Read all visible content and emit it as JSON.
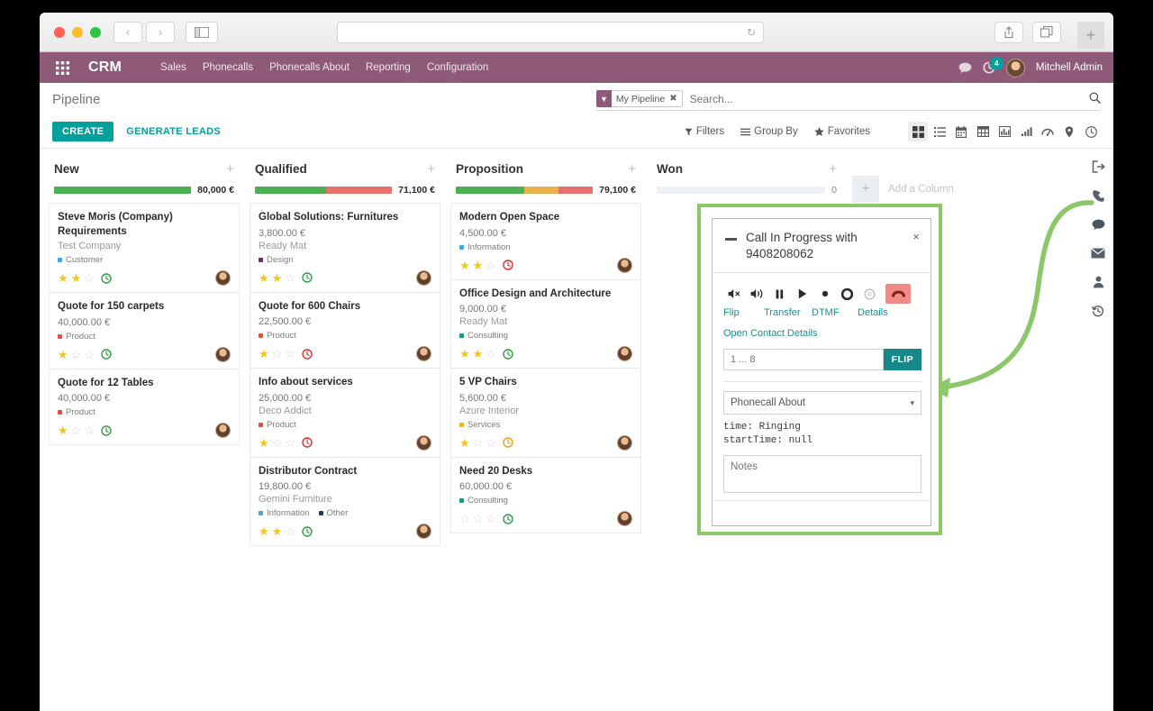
{
  "browser": {
    "traffic_lights": [
      "close",
      "minimize",
      "maximize"
    ],
    "back_label": "‹",
    "forward_label": "›",
    "sidebar_icon": "sidebar-toggle-icon",
    "address_value": "",
    "reload_label": "↻",
    "share_icon": "share-icon",
    "tabs_icon": "tab-overview-icon",
    "newtab_label": "+"
  },
  "nav": {
    "apps_icon": "apps-grid-icon",
    "brand": "CRM",
    "menu": [
      "Sales",
      "Phonecalls",
      "Phonecalls About",
      "Reporting",
      "Configuration"
    ],
    "messages_icon": "chat-bubble-icon",
    "activity_icon": "activity-clock-icon",
    "activity_count": "4",
    "user": "Mitchell Admin",
    "bg_color": "#8f5a78"
  },
  "control_panel": {
    "breadcrumb": "Pipeline",
    "create_label": "CREATE",
    "generate_leads_label": "GENERATE LEADS",
    "accent_color": "#00a09d",
    "search": {
      "facet_label": "My Pipeline",
      "facet_remove": "✖",
      "placeholder": "Search...",
      "value": ""
    },
    "filters_label": "Filters",
    "groupby_label": "Group By",
    "favorites_label": "Favorites",
    "views": [
      {
        "name": "kanban",
        "glyph": "kanban-view-icon",
        "active": true
      },
      {
        "name": "list",
        "glyph": "list-view-icon",
        "active": false
      },
      {
        "name": "calendar",
        "glyph": "calendar-view-icon",
        "active": false
      },
      {
        "name": "pivot",
        "glyph": "pivot-view-icon",
        "active": false
      },
      {
        "name": "graph-bar",
        "glyph": "bar-chart-view-icon",
        "active": false
      },
      {
        "name": "graph-line",
        "glyph": "line-chart-view-icon",
        "active": false
      },
      {
        "name": "dashboard",
        "glyph": "gauge-view-icon",
        "active": false
      },
      {
        "name": "map",
        "glyph": "map-pin-view-icon",
        "active": false
      },
      {
        "name": "activity",
        "glyph": "clock-view-icon",
        "active": false
      }
    ]
  },
  "kanban": {
    "add_column_label": "Add a Column",
    "add_column_plus": "+",
    "columns": [
      {
        "title": "New",
        "amount": "80,000 €",
        "meter": [
          {
            "color": "#4caf50",
            "pct": 100
          }
        ],
        "cards": [
          {
            "title": "Steve Moris (Company) Requirements",
            "amount": "",
            "partner": "Test Company",
            "tags": [
              {
                "label": "Customer",
                "color": "#3fa9d8"
              }
            ],
            "stars": 2,
            "clock_color": "#2f9e44"
          },
          {
            "title": "Quote for 150 carpets",
            "amount": "40,000.00 €",
            "partner": "",
            "tags": [
              {
                "label": "Product",
                "color": "#e74c3c"
              }
            ],
            "stars": 1,
            "clock_color": "#2f9e44"
          },
          {
            "title": "Quote for 12 Tables",
            "amount": "40,000.00 €",
            "partner": "",
            "tags": [
              {
                "label": "Product",
                "color": "#e74c3c"
              }
            ],
            "stars": 1,
            "clock_color": "#2f9e44"
          }
        ]
      },
      {
        "title": "Qualified",
        "amount": "71,100 €",
        "meter": [
          {
            "color": "#4caf50",
            "pct": 52
          },
          {
            "color": "#e8716b",
            "pct": 48
          }
        ],
        "cards": [
          {
            "title": "Global Solutions: Furnitures",
            "amount": "3,800.00 €",
            "partner": "Ready Mat",
            "tags": [
              {
                "label": "Design",
                "color": "#6b2f6b"
              }
            ],
            "stars": 2,
            "clock_color": "#2f9e44"
          },
          {
            "title": "Quote for 600 Chairs",
            "amount": "22,500.00 €",
            "partner": "",
            "tags": [
              {
                "label": "Product",
                "color": "#e74c3c"
              }
            ],
            "stars": 1,
            "clock_color": "#e03131"
          },
          {
            "title": "Info about services",
            "amount": "25,000.00 €",
            "partner": "Deco Addict",
            "tags": [
              {
                "label": "Product",
                "color": "#e74c3c"
              }
            ],
            "stars": 1,
            "clock_color": "#e03131"
          },
          {
            "title": "Distributor Contract",
            "amount": "19,800.00 €",
            "partner": "Gemini Furniture",
            "tags": [
              {
                "label": "Information",
                "color": "#3fa9d8"
              },
              {
                "label": "Other",
                "color": "#1f3864"
              }
            ],
            "stars": 2,
            "clock_color": "#2f9e44"
          }
        ]
      },
      {
        "title": "Proposition",
        "amount": "79,100 €",
        "meter": [
          {
            "color": "#4caf50",
            "pct": 50
          },
          {
            "color": "#e9b04b",
            "pct": 25
          },
          {
            "color": "#e8716b",
            "pct": 25
          }
        ],
        "cards": [
          {
            "title": "Modern Open Space",
            "amount": "4,500.00 €",
            "partner": "",
            "tags": [
              {
                "label": "Information",
                "color": "#3fa9d8"
              }
            ],
            "stars": 2,
            "clock_color": "#e03131"
          },
          {
            "title": "Office Design and Architecture",
            "amount": "9,000.00 €",
            "partner": "Ready Mat",
            "tags": [
              {
                "label": "Consulting",
                "color": "#139a8f"
              }
            ],
            "stars": 2,
            "clock_color": "#2f9e44"
          },
          {
            "title": "5 VP Chairs",
            "amount": "5,600.00 €",
            "partner": "Azure Interior",
            "tags": [
              {
                "label": "Services",
                "color": "#f2b705"
              }
            ],
            "stars": 1,
            "clock_color": "#e8a317"
          },
          {
            "title": "Need 20 Desks",
            "amount": "60,000.00 €",
            "partner": "",
            "tags": [
              {
                "label": "Consulting",
                "color": "#139a8f"
              }
            ],
            "stars": 0,
            "clock_color": "#2f9e44"
          }
        ]
      },
      {
        "title": "Won",
        "amount": "0",
        "meter": [],
        "cards": []
      }
    ]
  },
  "rail": {
    "icons": [
      {
        "name": "logout-icon",
        "glyph": "⇥"
      },
      {
        "name": "phone-icon",
        "glyph": "phone"
      },
      {
        "name": "chat-icon",
        "glyph": "chat"
      },
      {
        "name": "email-icon",
        "glyph": "mail"
      },
      {
        "name": "contact-icon",
        "glyph": "user"
      },
      {
        "name": "history-icon",
        "glyph": "history"
      }
    ]
  },
  "call_dialog": {
    "highlight_color": "#8cc76a",
    "minimize_label": "",
    "title": "Call In Progress with 9408208062",
    "close_label": "×",
    "controls": [
      {
        "name": "mute-icon",
        "disabled": false
      },
      {
        "name": "volume-icon",
        "disabled": false
      },
      {
        "name": "pause-icon",
        "disabled": false
      },
      {
        "name": "play-icon",
        "disabled": false
      },
      {
        "name": "record-icon",
        "disabled": false
      },
      {
        "name": "stop-icon",
        "disabled": false
      },
      {
        "name": "park-icon",
        "disabled": true
      }
    ],
    "hangup_name": "hangup-button",
    "action_labels": [
      "Flip",
      "Transfer",
      "DTMF",
      "Details"
    ],
    "open_contact_label": "Open Contact Details",
    "flip_input_placeholder": "1 ... 8",
    "flip_input_value": "",
    "flip_button_label": "FLIP",
    "about_select_value": "Phonecall About",
    "status_lines": [
      "time: Ringing",
      "startTime: null"
    ],
    "notes_placeholder": "Notes",
    "notes_value": ""
  }
}
